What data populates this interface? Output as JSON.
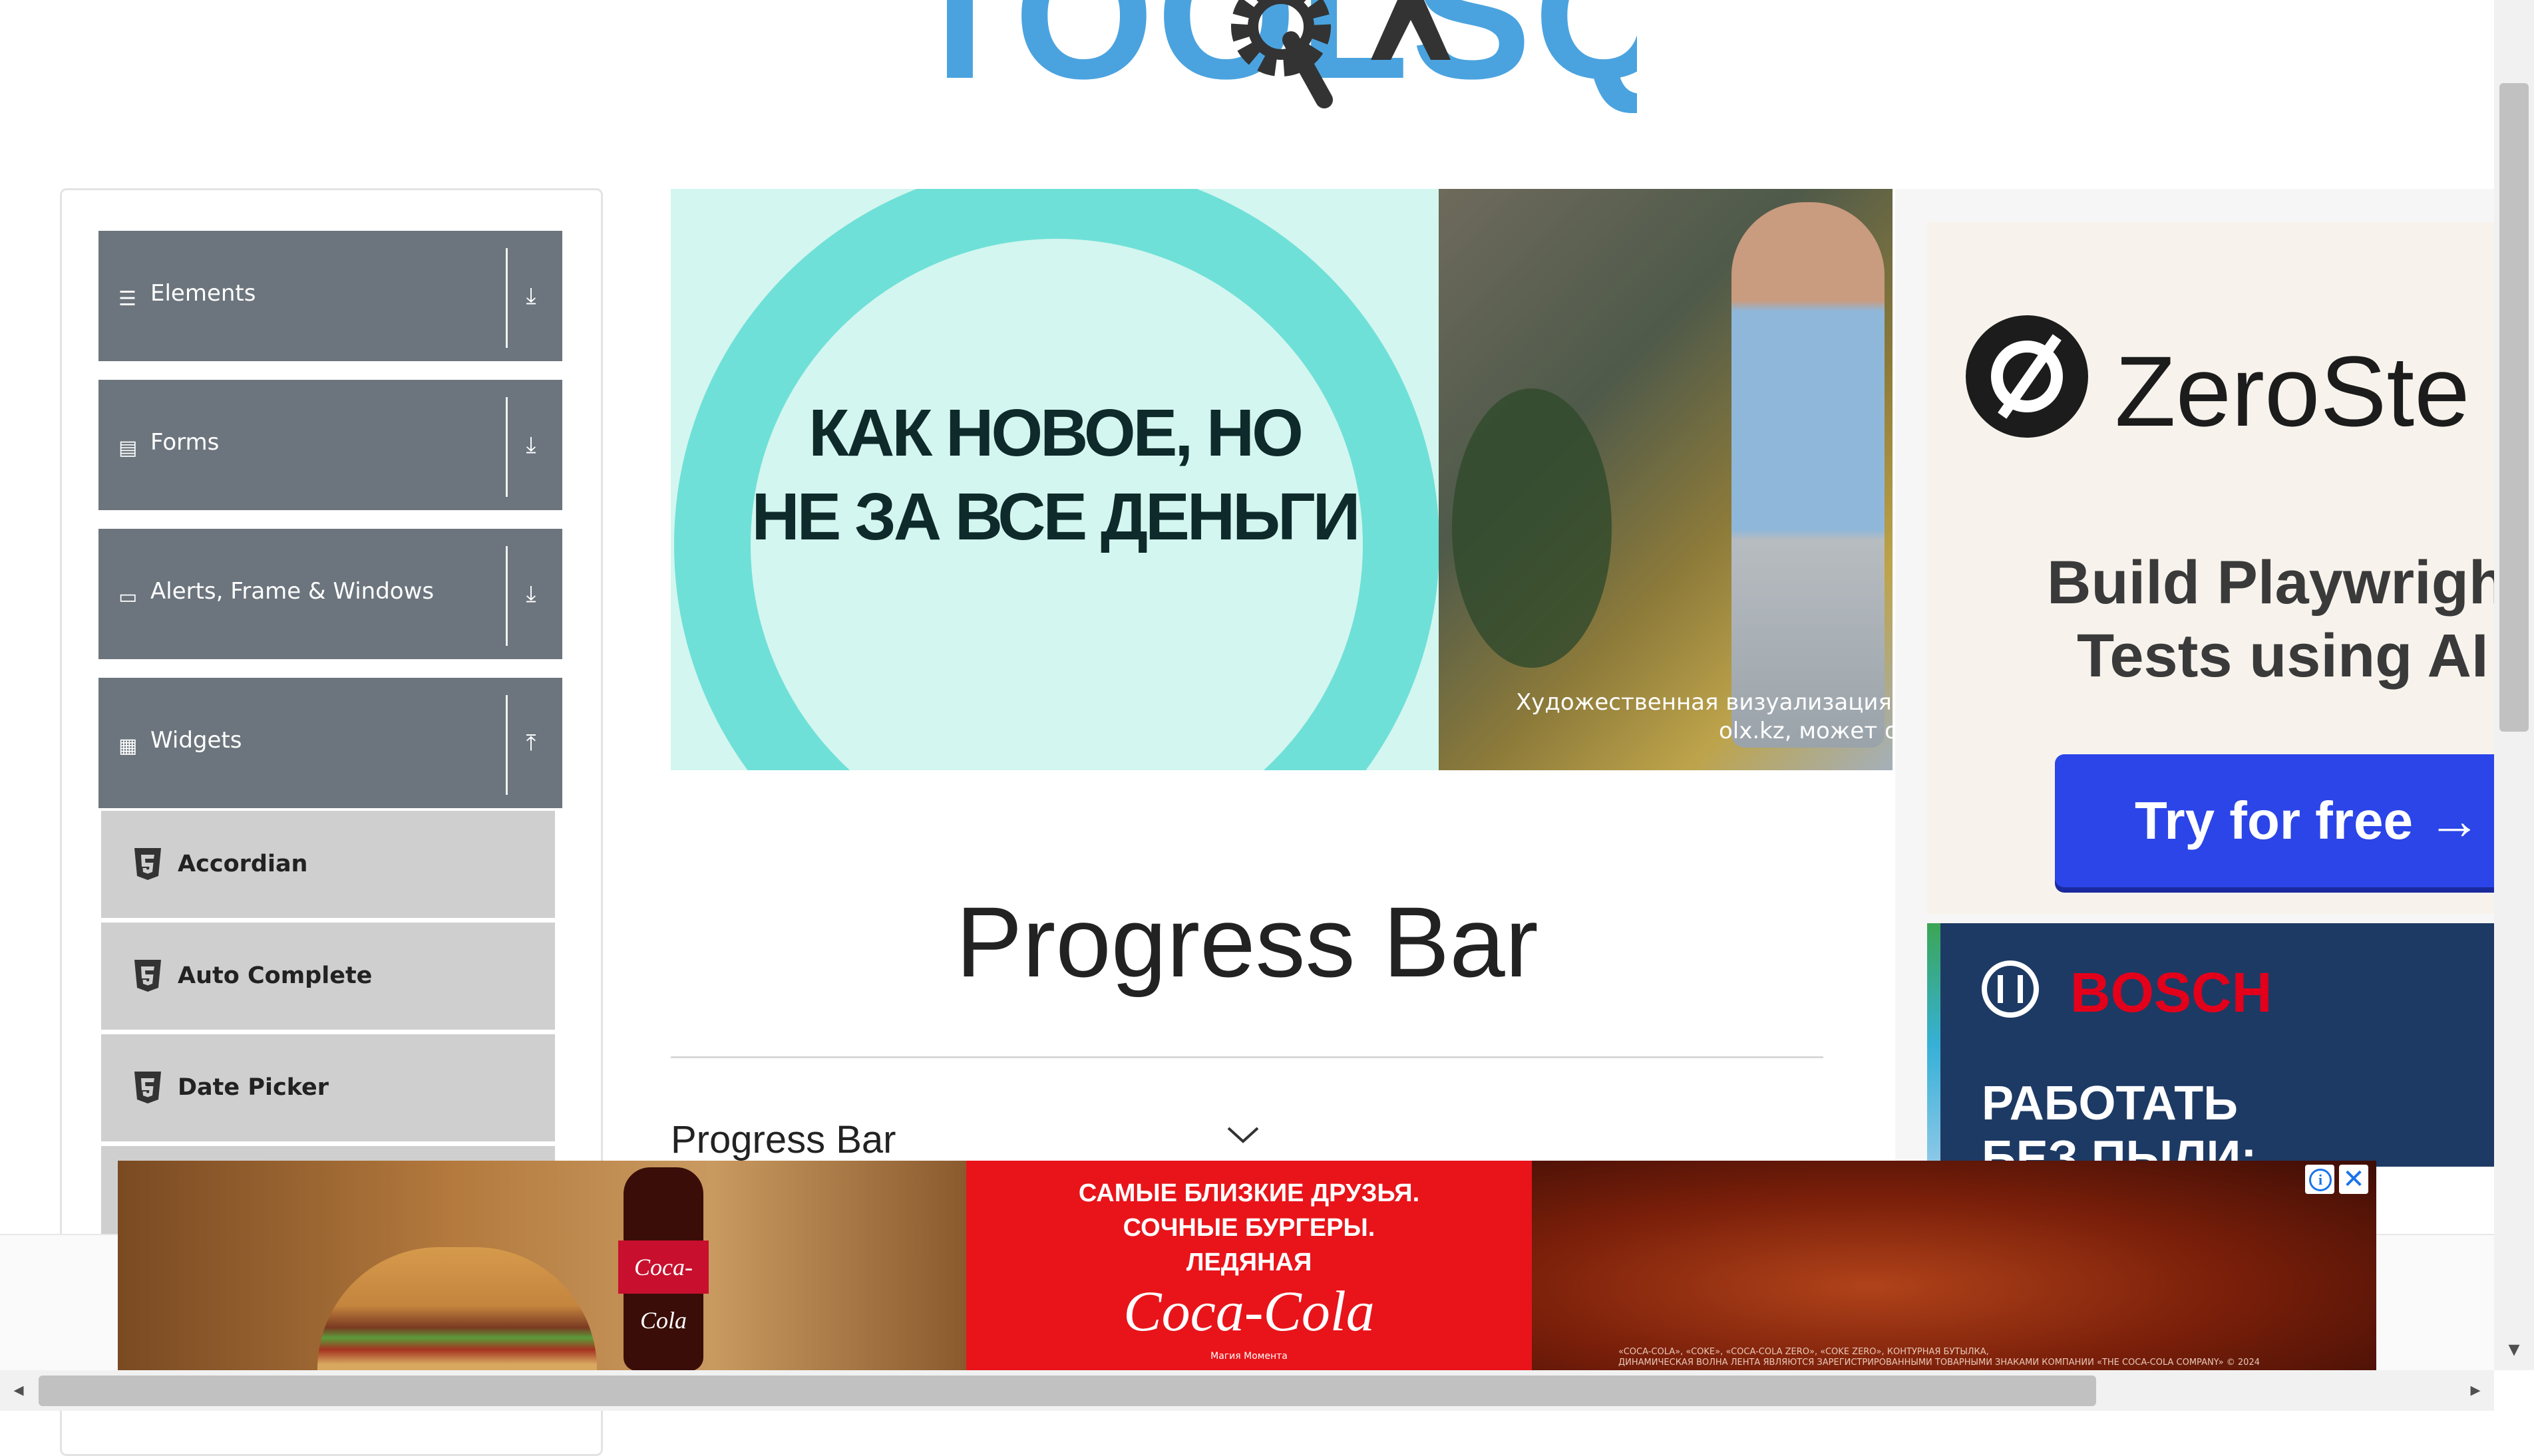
{
  "header": {
    "logo_text": "TOOLSQA"
  },
  "sidebar": {
    "groups": [
      {
        "label": "Elements",
        "icon": "list-icon",
        "expanded": false
      },
      {
        "label": "Forms",
        "icon": "document-icon",
        "expanded": false
      },
      {
        "label": "Alerts, Frame & Windows",
        "icon": "window-icon",
        "expanded": false
      },
      {
        "label": "Widgets",
        "icon": "grid-icon",
        "expanded": true
      }
    ],
    "widget_items": [
      {
        "label": "Accordian",
        "icon": "html5-icon"
      },
      {
        "label": "Auto Complete",
        "icon": "html5-icon"
      },
      {
        "label": "Date Picker",
        "icon": "html5-icon"
      }
    ]
  },
  "banner_ad": {
    "headline_line1": "КАК НОВОЕ, НО",
    "headline_line2": "НЕ ЗА ВСЕ ДЕНЬГИ",
    "caption_line1": "Художественная визуализация о",
    "caption_line2": "olx.kz, может о"
  },
  "main": {
    "page_title": "Progress Bar",
    "section_label": "Progress Bar"
  },
  "right_ad": {
    "brand": "ZeroSte",
    "tagline_line1": "Build Playwright",
    "tagline_line2": "Tests using AI",
    "cta": "Try for free →",
    "bosch_brand": "BOSCH",
    "bosch_line1": "РАБОТАТЬ",
    "bosch_line2": "БЕЗ ПЫЛИ:"
  },
  "bottom_ad": {
    "bottle_label": "Coca-Cola",
    "line1": "САМЫЕ БЛИЗКИЕ ДРУЗЬЯ.",
    "line2": "СОЧНЫЕ БУРГЕРЫ.",
    "line3": "ЛЕДЯНАЯ",
    "logo": "Coca-Cola",
    "small": "Магия Момента",
    "fine1": "«COCA-COLA», «COKE», «COCA-COLA ZERO», «COKE ZERO», КОНТУРНАЯ БУТЫЛКА,",
    "fine2": "ДИНАМИЧЕСКАЯ ВОЛНА ЛЕНТА ЯВЛЯЮТСЯ ЗАРЕГИСТРИРОВАННЫМИ ТОВАРНЫМИ ЗНАКАМИ КОМПАНИИ «THE COCA-COLA COMPANY» © 2024"
  },
  "colors": {
    "sidebar_header": "#6c757d",
    "sidebar_item": "#cfcfcf",
    "cta_blue": "#2b45e8",
    "bosch_red": "#e3001b",
    "coke_red": "#e8141a"
  }
}
